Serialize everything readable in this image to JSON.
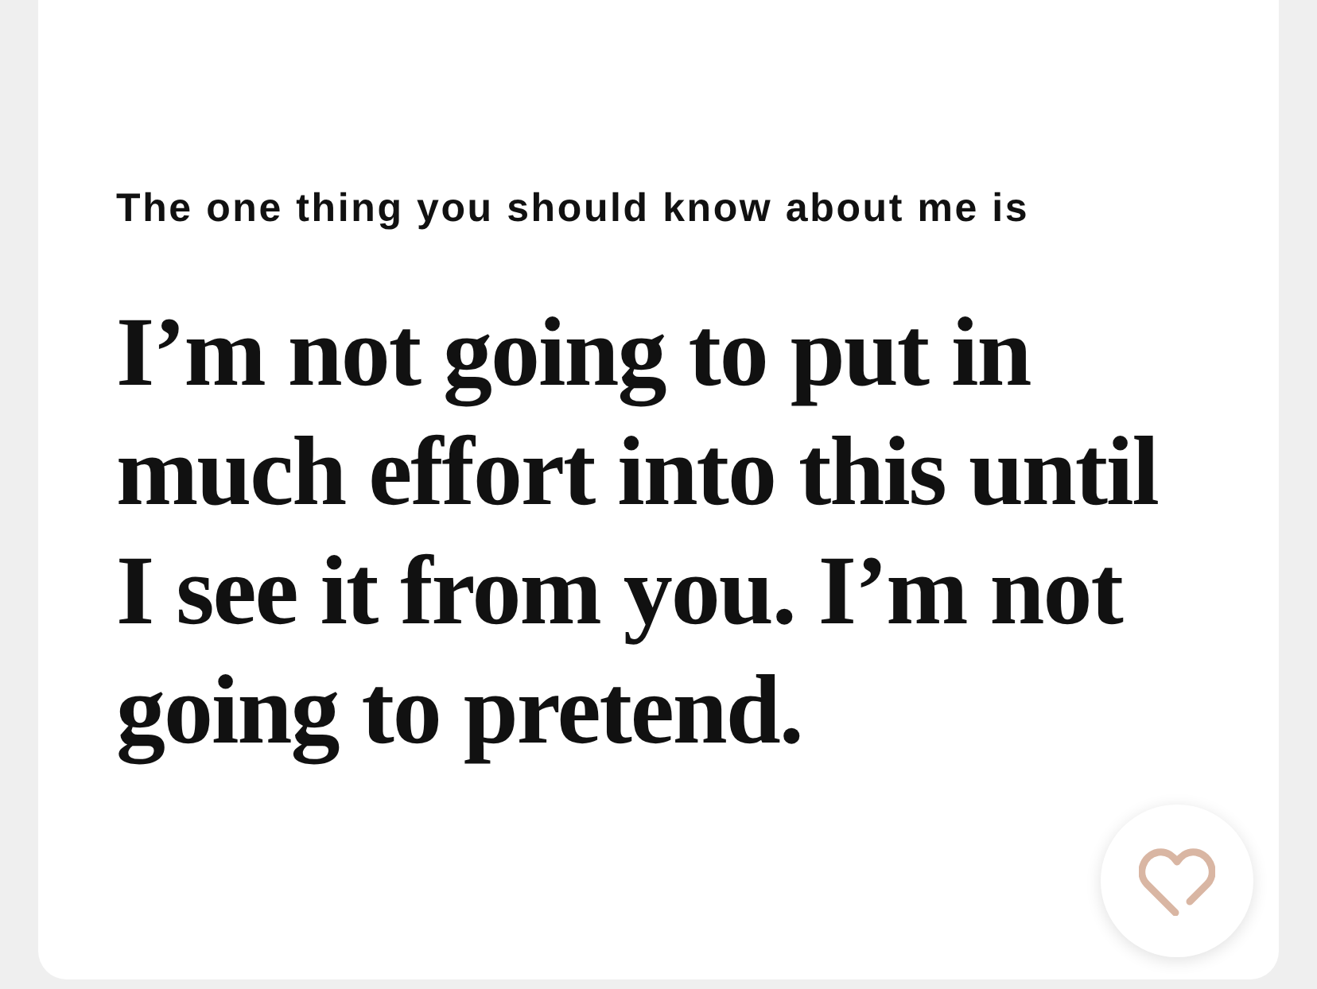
{
  "card": {
    "prompt": "The one thing you should know about me is",
    "answer": "I’m not going to put in much effort into this until I see it from you. I’m not going to pretend."
  }
}
